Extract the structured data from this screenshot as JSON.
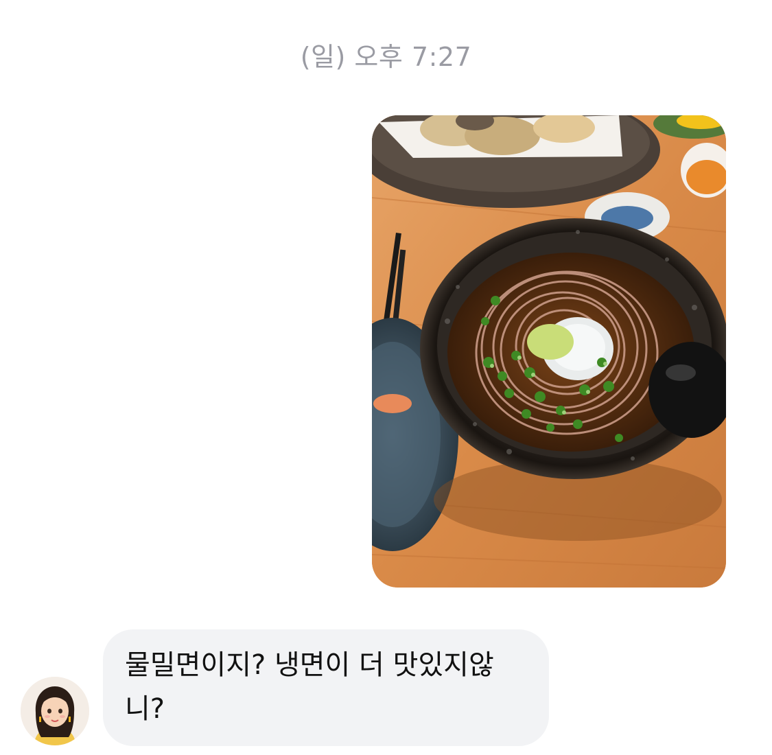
{
  "conversation": {
    "timestamp": "(일) 오후 7:27",
    "messages": [
      {
        "direction": "outgoing",
        "type": "photo",
        "photo": {
          "subject": "soba-noodle-bowl-photo"
        }
      },
      {
        "direction": "incoming",
        "type": "text",
        "sender_avatar_icon": "girl-avatar-icon",
        "text": "물밀면이지? 냉면이 더 맛있지않니?"
      }
    ]
  },
  "colors": {
    "background": "#ffffff",
    "timestamp_text": "#9a9ba3",
    "incoming_bubble": "#f2f3f5",
    "message_text": "#111111"
  }
}
